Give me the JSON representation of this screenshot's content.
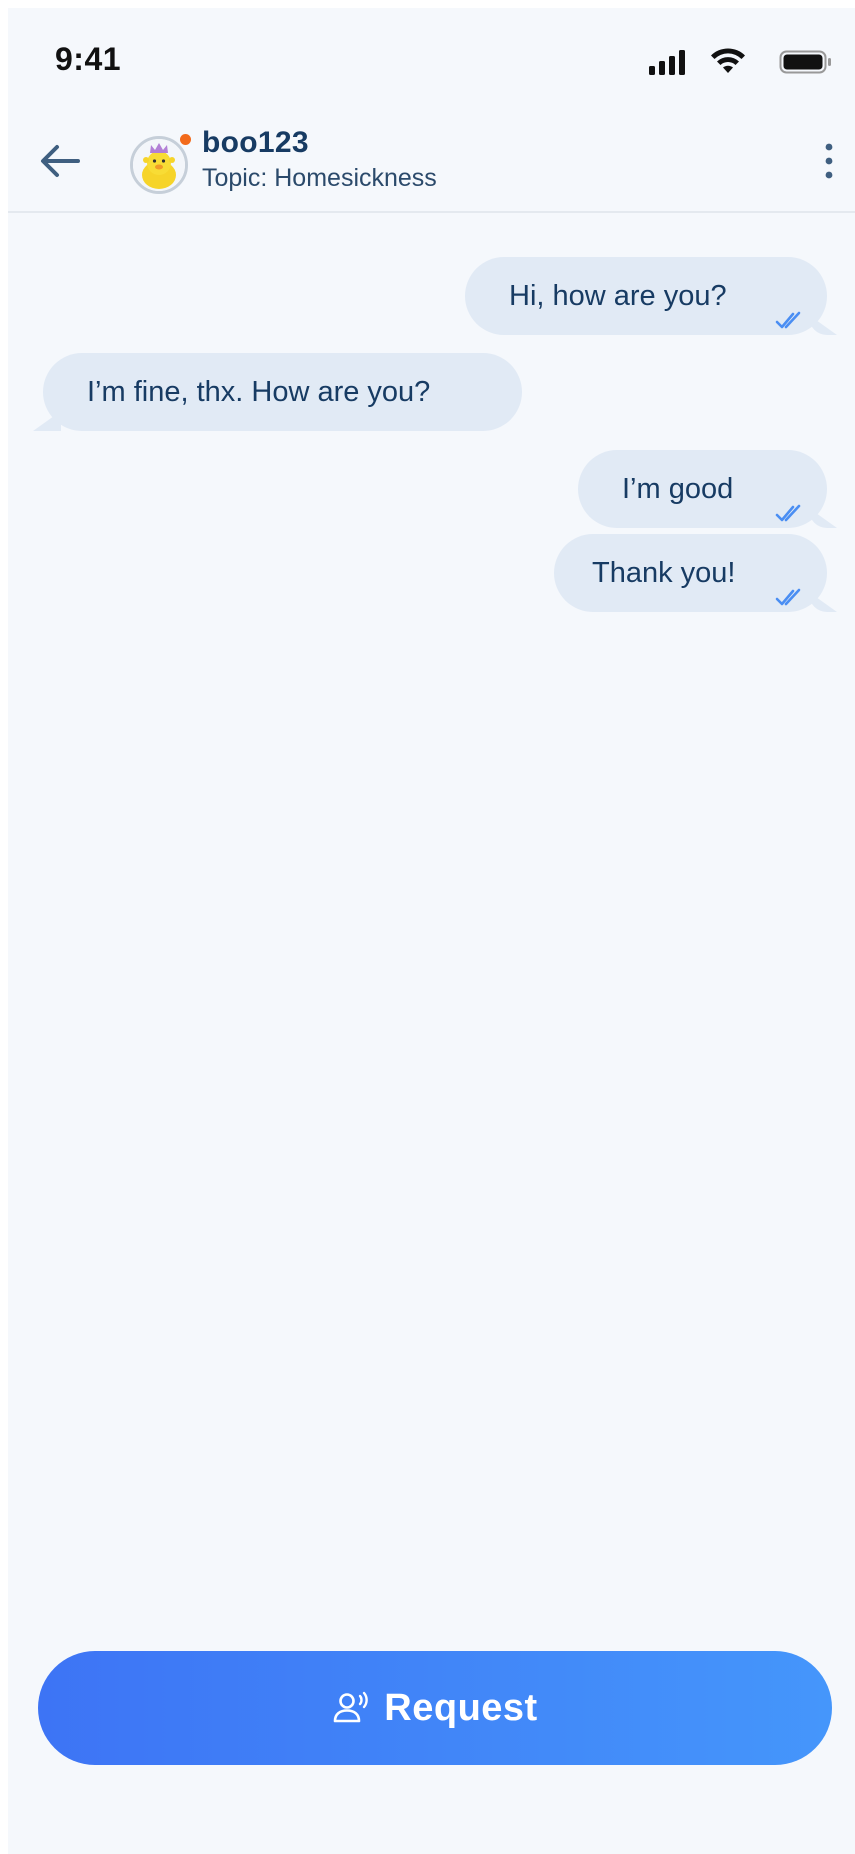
{
  "status_bar": {
    "time": "9:41",
    "icons": [
      "signal-icon",
      "wifi-icon",
      "battery-icon"
    ]
  },
  "header": {
    "back_icon": "arrow-left-icon",
    "user_name": "boo123",
    "online": true,
    "topic": "Topic: Homesickness",
    "more_icon": "more-vertical-icon"
  },
  "messages": [
    {
      "direction": "sent",
      "text": "Hi, how are you?",
      "read": true
    },
    {
      "direction": "received",
      "text": "I’m fine, thx. How are you?"
    },
    {
      "direction": "sent",
      "text": "I’m good",
      "read": true
    },
    {
      "direction": "sent",
      "text": "Thank you!",
      "read": true
    }
  ],
  "footer": {
    "request_label": "Request",
    "request_icon": "person-voice-icon"
  },
  "colors": {
    "background": "#f5f8fc",
    "bubble": "#e1eaf5",
    "text_dark": "#173b63",
    "check": "#4a8ef3",
    "button_start": "#3d74f5",
    "button_end": "#4596fb",
    "online_dot": "#f26a1b"
  }
}
